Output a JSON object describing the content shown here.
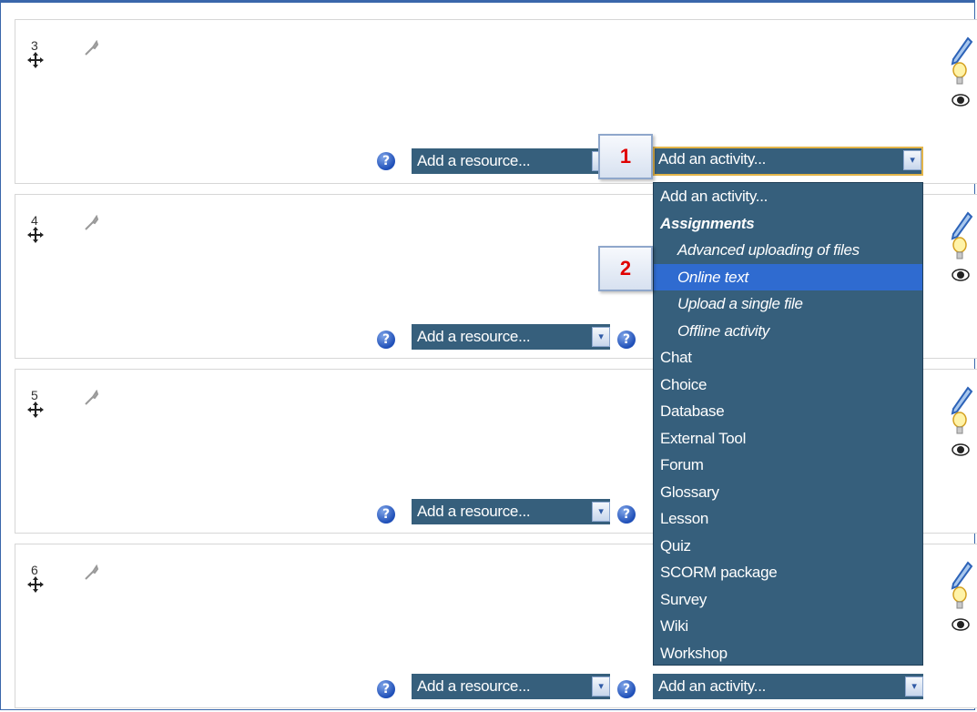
{
  "sections": [
    {
      "number": "3",
      "resource_select": "Add a resource...",
      "activity_select": "Add an activity..."
    },
    {
      "number": "4",
      "resource_select": "Add a resource..."
    },
    {
      "number": "5",
      "resource_select": "Add a resource..."
    },
    {
      "number": "6",
      "resource_select": "Add a resource...",
      "activity_select": "Add an activity..."
    }
  ],
  "help_glyph": "?",
  "dropdown_arrow": "▾",
  "callouts": [
    "1",
    "2"
  ],
  "activity_dropdown": {
    "options": [
      {
        "label": "Add an activity...",
        "kind": "option"
      },
      {
        "label": "Assignments",
        "kind": "group"
      },
      {
        "label": "Advanced uploading of files",
        "kind": "child"
      },
      {
        "label": "Online text",
        "kind": "child",
        "highlighted": true
      },
      {
        "label": "Upload a single file",
        "kind": "child"
      },
      {
        "label": "Offline activity",
        "kind": "child"
      },
      {
        "label": "Chat",
        "kind": "option"
      },
      {
        "label": "Choice",
        "kind": "option"
      },
      {
        "label": "Database",
        "kind": "option"
      },
      {
        "label": "External Tool",
        "kind": "option"
      },
      {
        "label": "Forum",
        "kind": "option"
      },
      {
        "label": "Glossary",
        "kind": "option"
      },
      {
        "label": "Lesson",
        "kind": "option"
      },
      {
        "label": "Quiz",
        "kind": "option"
      },
      {
        "label": "SCORM package",
        "kind": "option"
      },
      {
        "label": "Survey",
        "kind": "option"
      },
      {
        "label": "Wiki",
        "kind": "option"
      },
      {
        "label": "Workshop",
        "kind": "option"
      }
    ]
  },
  "colors": {
    "select_bg": "#365f7c",
    "highlight": "#2f6bd0",
    "callout_text": "#e00000",
    "frame": "#3a67ab"
  }
}
